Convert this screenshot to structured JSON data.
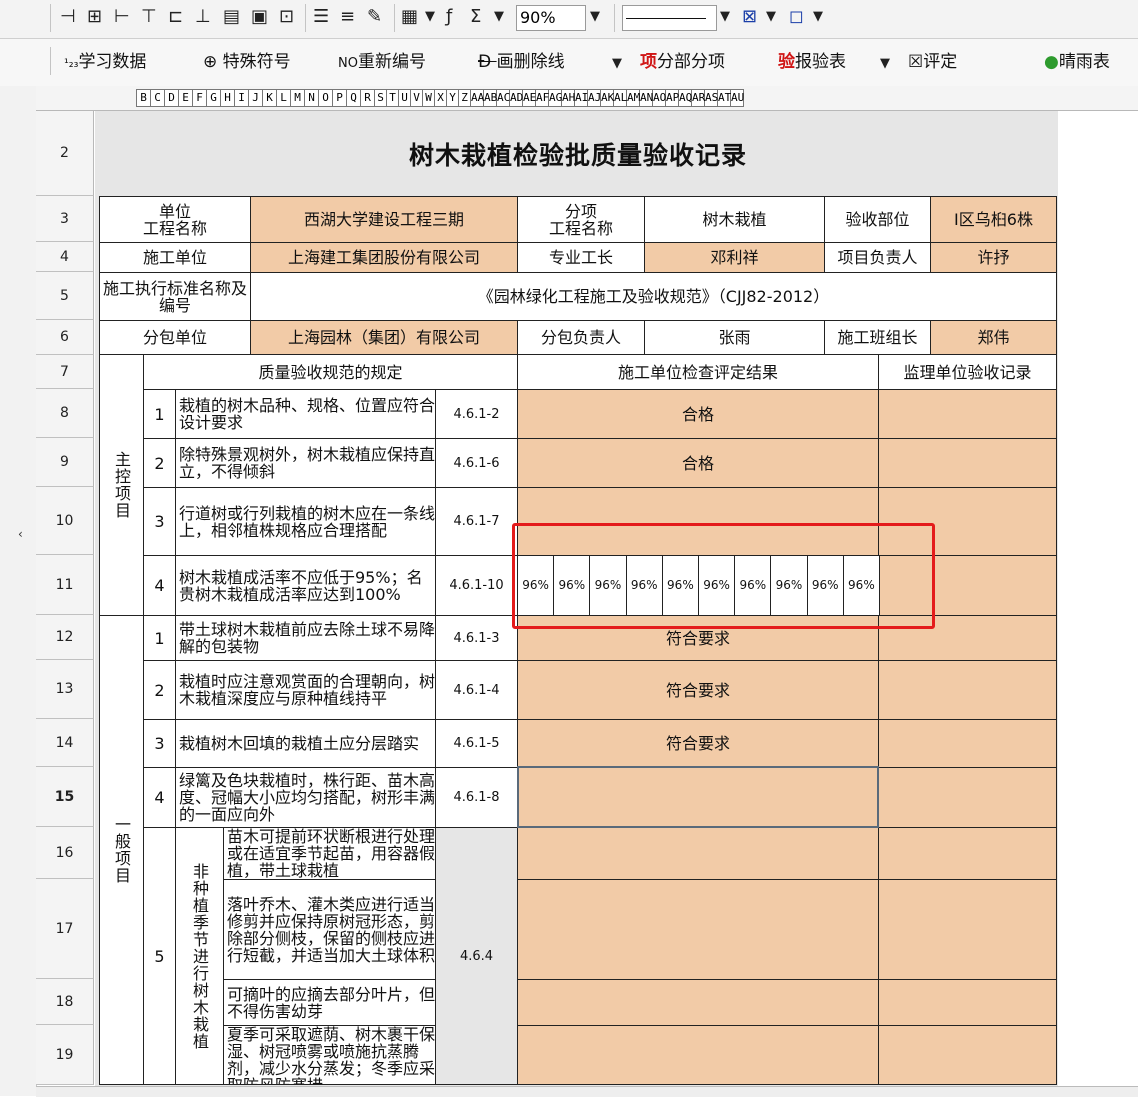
{
  "toolbar": {
    "icons_row1": [
      "split-cells-icon",
      "merge-cells-icon",
      "insert-row-icon",
      "insert-col-icon",
      "delete-row-icon",
      "delete-col-icon",
      "print-icon",
      "save-icon",
      "lock-icon",
      "align-icon",
      "indent-icon",
      "format-painter-icon",
      "chart-icon",
      "formula-icon",
      "sum-icon"
    ],
    "sigma": "Σ",
    "zoom_value": "90%"
  },
  "toolbar2": {
    "study_data": "学习数据",
    "special_symbols": "特殊符号",
    "renumber": "重新编号",
    "strikethrough": "画删除线",
    "subitem_red": "项",
    "subitem": "分部分项",
    "inspect_red": "验",
    "inspect": "报验表",
    "evaluate": "评定",
    "weather": "晴雨表"
  },
  "column_letters": [
    "B",
    "C",
    "D",
    "E",
    "F",
    "G",
    "H",
    "I",
    "J",
    "K",
    "L",
    "M",
    "N",
    "O",
    "P",
    "Q",
    "R",
    "S",
    "T",
    "U",
    "V",
    "W",
    "X",
    "Y",
    "Z",
    "AA",
    "AB",
    "AC",
    "AD",
    "AE",
    "AF",
    "AG",
    "AH",
    "AI",
    "AJ",
    "AK",
    "AL",
    "AM",
    "AN",
    "AO",
    "AP",
    "AQ",
    "AR",
    "AS",
    "AT",
    "AU"
  ],
  "row_numbers": [
    "2",
    "3",
    "4",
    "5",
    "6",
    "7",
    "8",
    "9",
    "10",
    "11",
    "12",
    "13",
    "14",
    "15",
    "16",
    "17",
    "18",
    "19"
  ],
  "form": {
    "title": "树木栽植检验批质量验收记录",
    "unit_name_label": "单位\n工程名称",
    "unit_name": "西湖大学建设工程三期",
    "subitem_name_label": "分项\n工程名称",
    "subitem_name": "树木栽植",
    "accept_part_label": "验收部位",
    "accept_part": "I区乌桕6株",
    "contractor_label": "施工单位",
    "contractor": "上海建工集团股份有限公司",
    "foreman_label": "专业工长",
    "foreman": "邓利祥",
    "pm_label": "项目负责人",
    "pm": "许抒",
    "standard_label": "施工执行标准名称及编号",
    "standard": "《园林绿化工程施工及验收规范》（CJJ82-2012）",
    "sub_unit_label": "分包单位",
    "sub_unit": "上海园林（集团）有限公司",
    "sub_lead_label": "分包负责人",
    "sub_lead": "张雨",
    "team_lead_label": "施工班组长",
    "team_lead": "郑伟",
    "spec_header": "质量验收规范的规定",
    "check_header": "施工单位检查评定结果",
    "supervisor_header": "监理单位验收记录",
    "main_control": "主控项目",
    "general": "一般项目",
    "main_items": [
      {
        "no": "1",
        "text": "栽植的树木品种、规格、位置应符合设计要求",
        "code": "4.6.1-2",
        "result": "合格"
      },
      {
        "no": "2",
        "text": "除特殊景观树外，树木栽植应保持直立，不得倾斜",
        "code": "4.6.1-6",
        "result": "合格"
      },
      {
        "no": "3",
        "text": "行道树或行列栽植的树木应在一条线上，相邻植株规格应合理搭配",
        "code": "4.6.1-7",
        "result": ""
      },
      {
        "no": "4",
        "text": "树木栽植成活率不应低于95%；名贵树木栽植成活率应达到100%",
        "code": "4.6.1-10",
        "result": ""
      }
    ],
    "survival_values": [
      "96%",
      "96%",
      "96%",
      "96%",
      "96%",
      "96%",
      "96%",
      "96%",
      "96%",
      "96%"
    ],
    "general_items": [
      {
        "no": "1",
        "text": "带土球树木栽植前应去除土球不易降解的包装物",
        "code": "4.6.1-3",
        "result": "符合要求"
      },
      {
        "no": "2",
        "text": "栽植时应注意观赏面的合理朝向，树木栽植深度应与原种植线持平",
        "code": "4.6.1-4",
        "result": "符合要求"
      },
      {
        "no": "3",
        "text": "栽植树木回填的栽植土应分层踏实",
        "code": "4.6.1-5",
        "result": "符合要求"
      },
      {
        "no": "4",
        "text": "绿篱及色块栽植时，株行距、苗木高度、冠幅大小应均匀搭配，树形丰满的一面应向外",
        "code": "4.6.1-8",
        "result": ""
      }
    ],
    "item5_no": "5",
    "item5_label": "非种植季节进行树木栽植",
    "item5_code": "4.6.4",
    "item5_subs": [
      "苗木可提前环状断根进行处理或在适宜季节起苗，用容器假植，带土球栽植",
      "落叶乔木、灌木类应进行适当修剪并应保持原树冠形态，剪除部分侧枝，保留的侧枝应进行短截，并适当加大土球体积",
      "可摘叶的应摘去部分叶片，但不得伤害幼芽",
      "夏季可采取遮荫、树木裹干保湿、树冠喷雾或喷施抗蒸腾剂，减少水分蒸发；冬季应采取防风防寒措"
    ]
  }
}
